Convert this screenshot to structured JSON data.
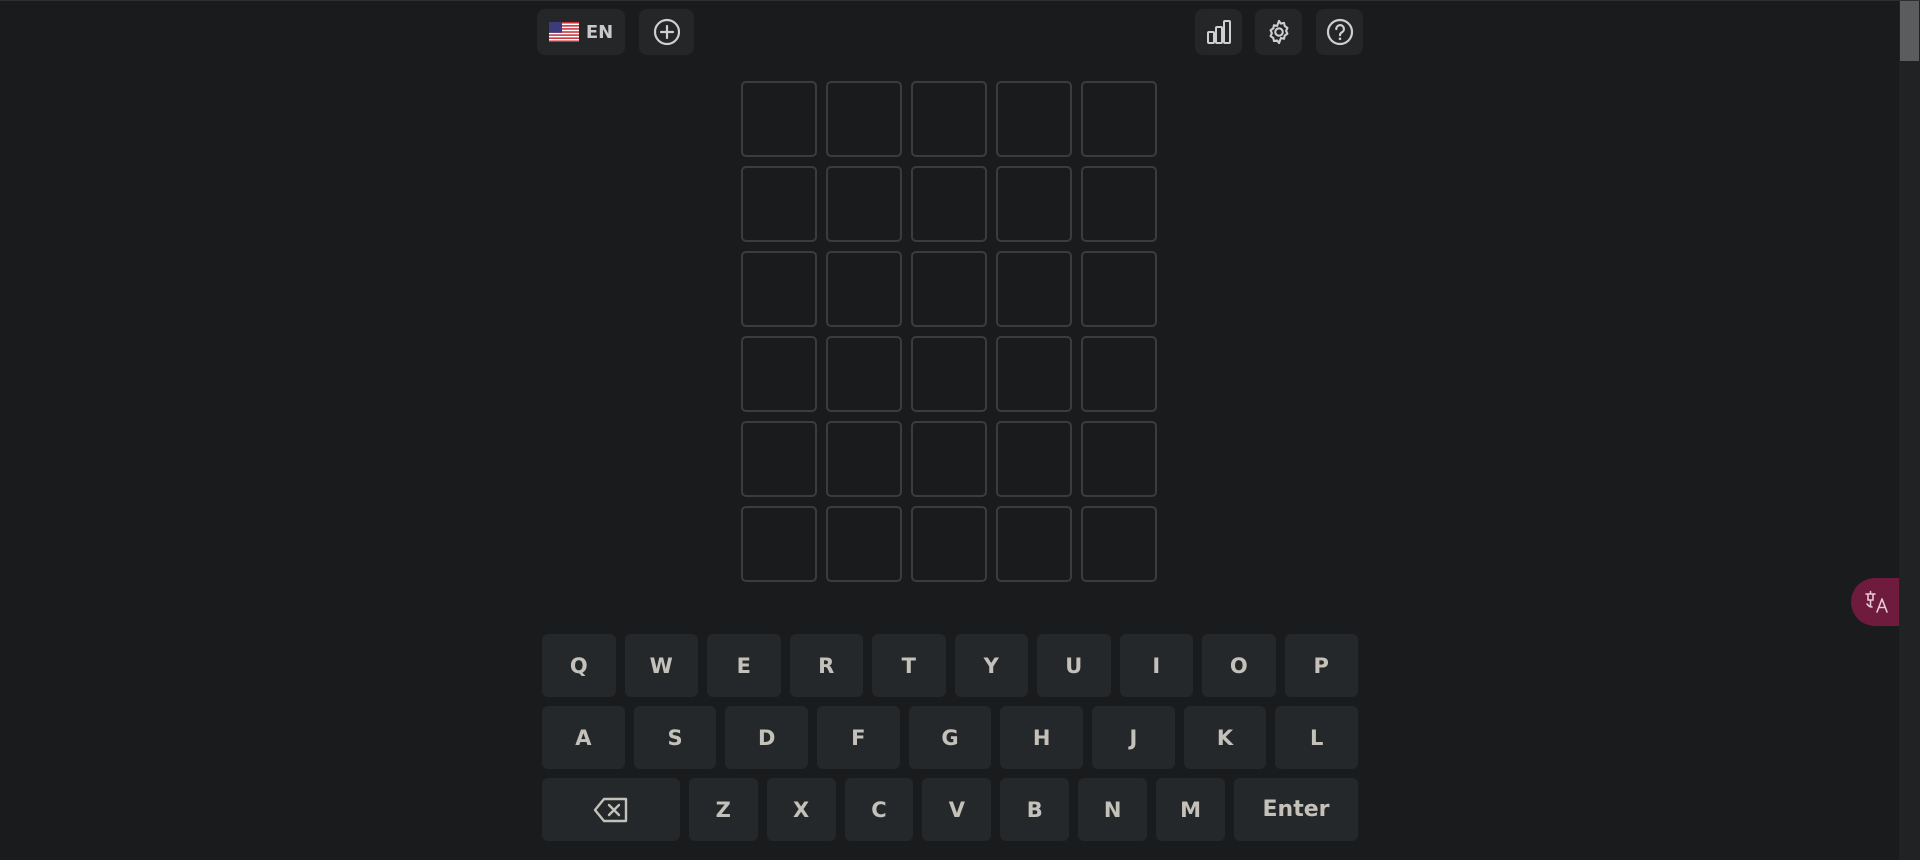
{
  "header": {
    "language_code": "EN",
    "language_flag_icon": "us-flag-icon",
    "new_game_icon": "plus-circle-icon",
    "stats_icon": "bar-chart-icon",
    "settings_icon": "gear-icon",
    "help_icon": "question-circle-icon"
  },
  "board": {
    "rows": 6,
    "cols": 5,
    "tiles": [
      [
        "",
        "",
        "",
        "",
        ""
      ],
      [
        "",
        "",
        "",
        "",
        ""
      ],
      [
        "",
        "",
        "",
        "",
        ""
      ],
      [
        "",
        "",
        "",
        "",
        ""
      ],
      [
        "",
        "",
        "",
        "",
        ""
      ],
      [
        "",
        "",
        "",
        "",
        ""
      ]
    ]
  },
  "keyboard": {
    "rows": [
      [
        "Q",
        "W",
        "E",
        "R",
        "T",
        "Y",
        "U",
        "I",
        "O",
        "P"
      ],
      [
        "A",
        "S",
        "D",
        "F",
        "G",
        "H",
        "J",
        "K",
        "L"
      ],
      [
        "Z",
        "X",
        "C",
        "V",
        "B",
        "N",
        "M"
      ]
    ],
    "backspace_icon": "backspace-icon",
    "enter_label": "Enter"
  },
  "translate_widget_icon": "translate-icon",
  "colors": {
    "background": "#1a1b1d",
    "tile_border": "#3a3c3e",
    "key_background": "#25282a",
    "key_text": "#c4c0ba",
    "header_button": "#242628",
    "translate_widget": "#6e1b3e"
  }
}
